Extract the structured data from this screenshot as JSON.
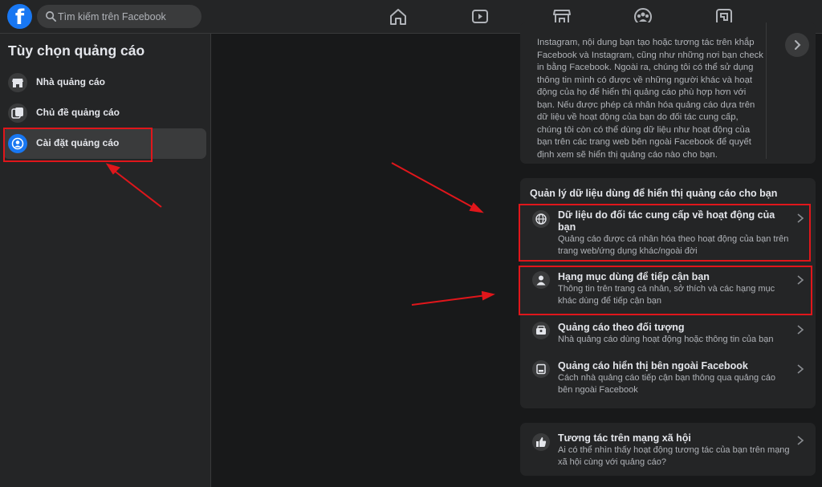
{
  "search": {
    "placeholder": "Tìm kiếm trên Facebook"
  },
  "sidebar": {
    "title": "Tùy chọn quảng cáo",
    "items": [
      {
        "label": "Nhà quảng cáo",
        "icon": "store-icon"
      },
      {
        "label": "Chủ đề quảng cáo",
        "icon": "topics-icon"
      },
      {
        "label": "Cài đặt quảng cáo",
        "icon": "user-circle-icon",
        "active": true
      }
    ]
  },
  "top_card": {
    "lines": [
      "Instagram, nội dung bạn tạo hoặc tương tác trên khắp",
      "Facebook và Instagram, cũng như những nơi bạn check",
      "in bằng Facebook. Ngoài ra, chúng tôi có thể sử dụng",
      "thông tin mình có được về những người khác và hoạt",
      "động của họ để hiển thị quảng cáo phù hợp hơn với",
      "bạn. Nếu được phép cá nhân hóa quảng cáo dựa trên",
      "dữ liệu về hoạt động của bạn do đối tác cung cấp,",
      "chúng tôi còn có thể dùng dữ liệu như hoạt động của",
      "bạn trên các trang web bên ngoài Facebook để quyết",
      "định xem sẽ hiển thị quảng cáo nào cho bạn."
    ]
  },
  "manage": {
    "heading": "Quản lý dữ liệu dùng để hiển thị quảng cáo cho bạn",
    "items": [
      {
        "title": "Dữ liệu do đối tác cung cấp về hoạt động của bạn",
        "desc": "Quảng cáo được cá nhân hóa theo hoạt động của bạn trên trang web/ứng dụng khác/ngoài đời",
        "icon": "globe-icon"
      },
      {
        "title": "Hạng mục dùng để tiếp cận bạn",
        "desc": "Thông tin trên trang cá nhân, sở thích và các hạng mục khác dùng để tiếp cận bạn",
        "icon": "person-icon"
      },
      {
        "title": "Quảng cáo theo đối tượng",
        "desc": "Nhà quảng cáo dùng hoạt động hoặc thông tin của bạn",
        "icon": "audience-icon"
      },
      {
        "title": "Quảng cáo hiển thị bên ngoài Facebook",
        "desc": "Cách nhà quảng cáo tiếp cận bạn thông qua quảng cáo bên ngoài Facebook",
        "icon": "external-ads-icon"
      }
    ]
  },
  "social": {
    "title": "Tương tác trên mạng xã hội",
    "desc": "Ai có thể nhìn thấy hoạt động tương tác của bạn trên mạng xã hội cùng với quảng cáo?",
    "icon": "thumbs-up-icon"
  },
  "colors": {
    "brand": "#1877f2",
    "background": "#18191a",
    "card": "#242526",
    "highlight": "#e0161b"
  }
}
